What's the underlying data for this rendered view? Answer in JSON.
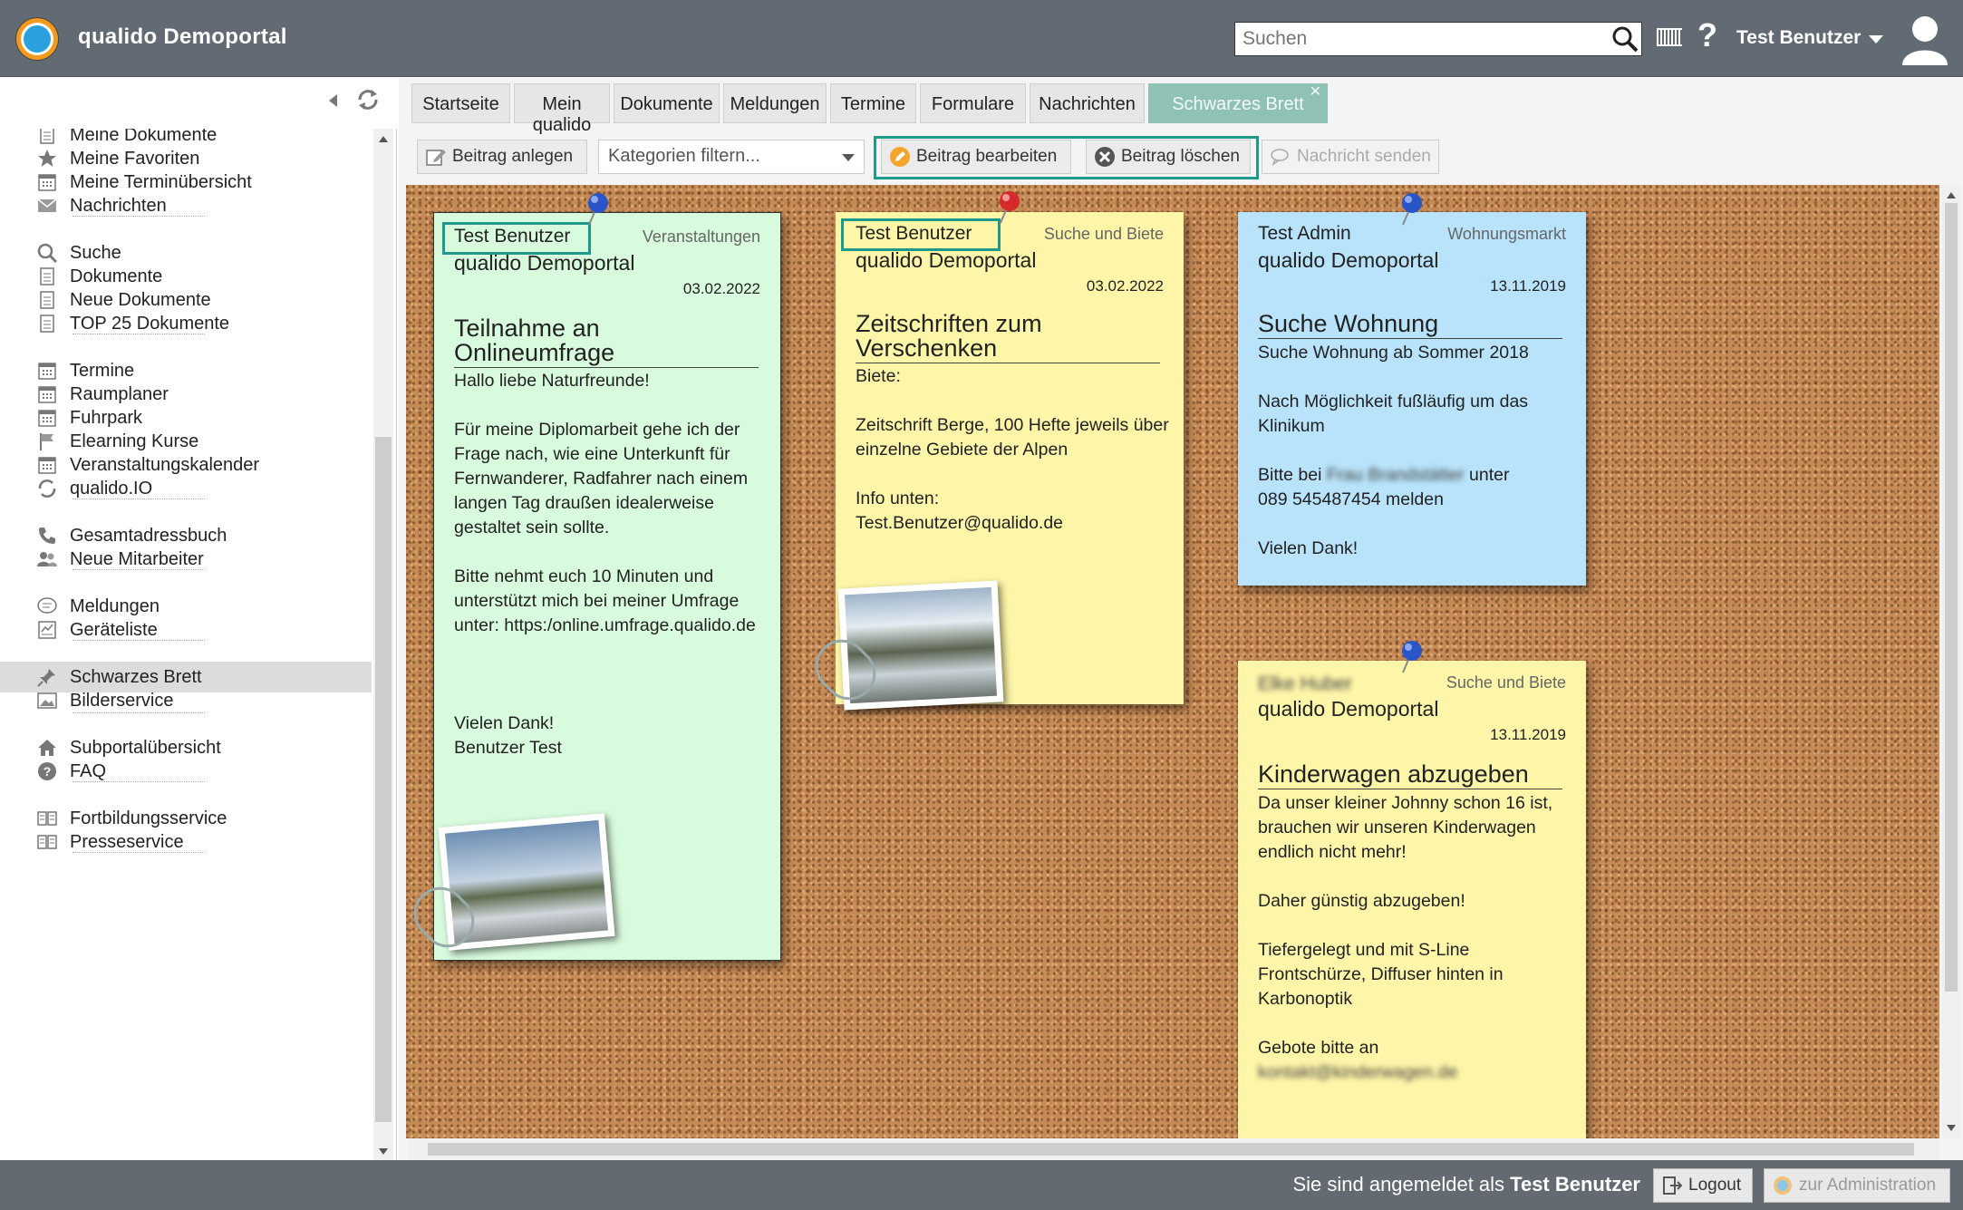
{
  "header": {
    "title": "qualido Demoportal",
    "search_placeholder": "Suchen",
    "user": "Test Benutzer",
    "help": "?"
  },
  "sidebar": {
    "items": [
      {
        "label": "Meine Dokumente",
        "icon": "document-icon"
      },
      {
        "label": "Meine Favoriten",
        "icon": "star-icon"
      },
      {
        "label": "Meine Terminübersicht",
        "icon": "calendar-icon"
      },
      {
        "label": "Nachrichten",
        "icon": "envelope-icon"
      },
      {
        "label": "Suche",
        "icon": "search-icon"
      },
      {
        "label": "Dokumente",
        "icon": "document-icon"
      },
      {
        "label": "Neue Dokumente",
        "icon": "document-icon"
      },
      {
        "label": "TOP 25 Dokumente",
        "icon": "document-icon"
      },
      {
        "label": "Termine",
        "icon": "calendar-icon"
      },
      {
        "label": "Raumplaner",
        "icon": "calendar-icon"
      },
      {
        "label": "Fuhrpark",
        "icon": "calendar-icon"
      },
      {
        "label": "Elearning Kurse",
        "icon": "flag-icon"
      },
      {
        "label": "Veranstaltungskalender",
        "icon": "calendar-icon"
      },
      {
        "label": "qualido.IO",
        "icon": "circle-arrows-icon"
      },
      {
        "label": "Gesamtadressbuch",
        "icon": "phone-icon"
      },
      {
        "label": "Neue Mitarbeiter",
        "icon": "people-icon"
      },
      {
        "label": "Meldungen",
        "icon": "speech-bubble-icon"
      },
      {
        "label": "Geräteliste",
        "icon": "device-list-icon"
      },
      {
        "label": "Schwarzes Brett",
        "icon": "pin-icon"
      },
      {
        "label": "Bilderservice",
        "icon": "image-icon"
      },
      {
        "label": "Subportalübersicht",
        "icon": "home-icon"
      },
      {
        "label": "FAQ",
        "icon": "question-icon"
      },
      {
        "label": "Fortbildungsservice",
        "icon": "book-icon"
      },
      {
        "label": "Presseservice",
        "icon": "book-icon"
      }
    ]
  },
  "tabs": [
    "Startseite",
    "Mein qualido",
    "Dokumente",
    "Meldungen",
    "Termine",
    "Formulare",
    "Nachrichten",
    "Schwarzes Brett"
  ],
  "toolbar": {
    "new_post": "Beitrag anlegen",
    "filter_placeholder": "Kategorien filtern...",
    "edit_post": "Beitrag bearbeiten",
    "delete_post": "Beitrag löschen",
    "send_message": "Nachricht senden"
  },
  "notes": [
    {
      "author": "Test Benutzer",
      "category": "Veranstaltungen",
      "portal": "qualido Demoportal",
      "date": "03.02.2022",
      "title": "Teilnahme an Onlineumfrage",
      "body": [
        "Hallo liebe Naturfreunde!",
        "Für meine Diplomarbeit gehe ich der Frage nach, wie eine Unterkunft für Fernwanderer, Radfahrer nach einem langen Tag draußen idealerweise gestaltet sein sollte.",
        "Bitte nehmt euch 10 Minuten und unterstützt mich bei meiner Umfrage unter: https:/online.umfrage.qualido.de",
        "",
        "Vielen Dank!\nBenutzer Test"
      ],
      "color": "#d8fadd",
      "pin": "#2a55c8"
    },
    {
      "author": "Test Benutzer",
      "category": "Suche und Biete",
      "portal": "qualido Demoportal",
      "date": "03.02.2022",
      "title": "Zeitschriften zum Verschenken",
      "body": [
        "Biete:",
        "Zeitschrift Berge, 100 Hefte jeweils über einzelne Gebiete der Alpen",
        "Info unten:\nTest.Benutzer@qualido.de"
      ],
      "color": "#fdf5a8",
      "pin": "#d42a2a"
    },
    {
      "author": "Test Admin",
      "category": "Wohnungsmarkt",
      "portal": "qualido Demoportal",
      "date": "13.11.2019",
      "title": "Suche Wohnung",
      "body": [
        "Suche Wohnung ab Sommer 2018",
        "Nach Möglichkeit fußläufig um das Klinikum"
      ],
      "contact_pre": "Bitte bei ",
      "contact_blur": "Frau Brandstätter",
      "contact_post": " unter",
      "contact_phone": "089 545487454 melden",
      "closing": "Vielen Dank!",
      "color": "#b8e3fa",
      "pin": "#2a55c8"
    },
    {
      "author_blur": "Elke Huber",
      "category": "Suche und Biete",
      "portal": "qualido Demoportal",
      "date": "13.11.2019",
      "title": "Kinderwagen abzugeben",
      "body": [
        "Da unser kleiner Johnny schon 16 ist, brauchen wir unseren Kinderwagen endlich nicht mehr!",
        "Daher günstig abzugeben!",
        "Tiefergelegt und mit S-Line Frontschürze, Diffuser hinten in Karbonoptik",
        "Gebote bitte an"
      ],
      "email_blur": "kontakt@kinderwagen.de",
      "color": "#fdf5a8",
      "pin": "#2a55c8"
    }
  ],
  "footer": {
    "login_prefix": "Sie sind angemeldet als ",
    "login_user": "Test Benutzer",
    "logout": "Logout",
    "admin": "zur Administration"
  },
  "colors": {
    "accent": "#1f9a8a",
    "topbar": "#626a73"
  }
}
